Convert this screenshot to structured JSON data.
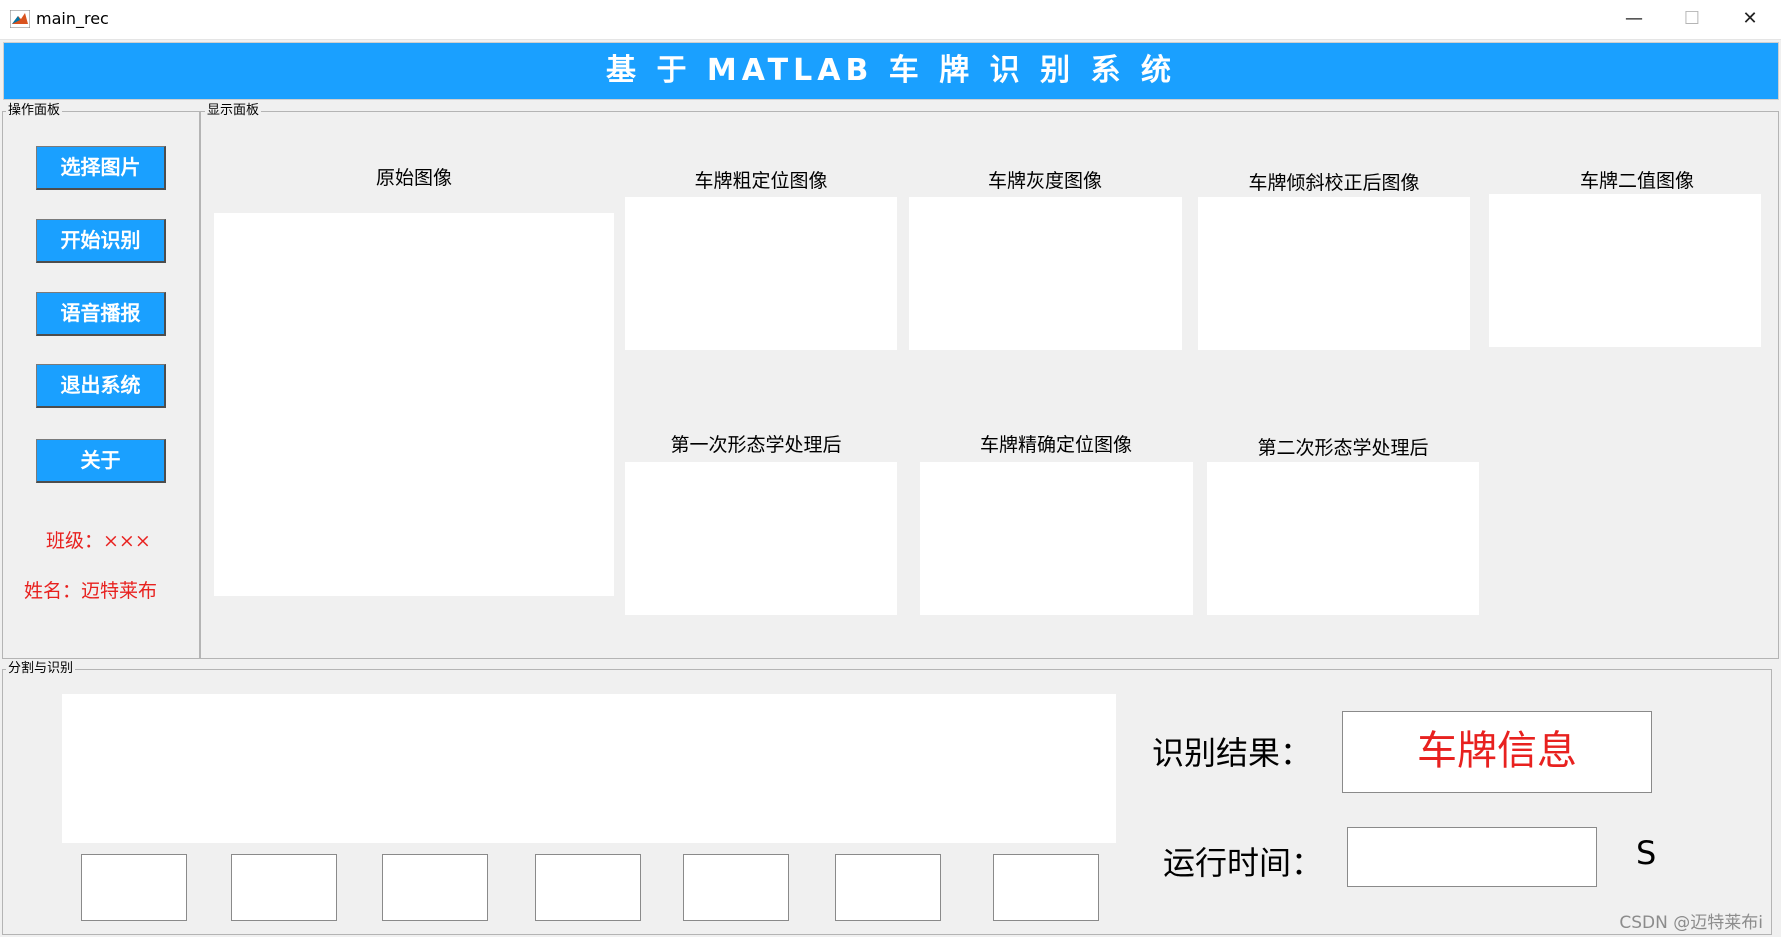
{
  "window": {
    "title": "main_rec",
    "minimize_icon": "minimize-icon",
    "maximize_icon": "maximize-icon",
    "close_icon": "close-icon"
  },
  "header": {
    "title": "基 于 MATLAB 车 牌 识 别 系 统",
    "bg_color": "#1aa0ff"
  },
  "op_panel": {
    "label": "操作面板",
    "buttons": [
      "选择图片",
      "开始识别",
      "语音播报",
      "退出系统",
      "关于"
    ],
    "class_text": "班级：×××",
    "name_text": "姓名：迈特莱布"
  },
  "display_panel": {
    "label": "显示面板",
    "axes": {
      "original": "原始图像",
      "coarse": "车牌粗定位图像",
      "gray": "车牌灰度图像",
      "tilt": "车牌倾斜校正后图像",
      "binary": "车牌二值图像",
      "morph1": "第一次形态学处理后",
      "precise": "车牌精确定位图像",
      "morph2": "第二次形态学处理后"
    }
  },
  "seg_panel": {
    "label": "分割与识别",
    "char_box_count": 7,
    "result_label": "识别结果：",
    "result_value": "车牌信息",
    "time_label": "运行时间：",
    "time_value": "",
    "time_unit": "S"
  },
  "watermark": "CSDN @迈特莱布i",
  "colors": {
    "accent": "#1aa0ff",
    "info_red": "#e8211f",
    "background": "#f0f0f0"
  }
}
